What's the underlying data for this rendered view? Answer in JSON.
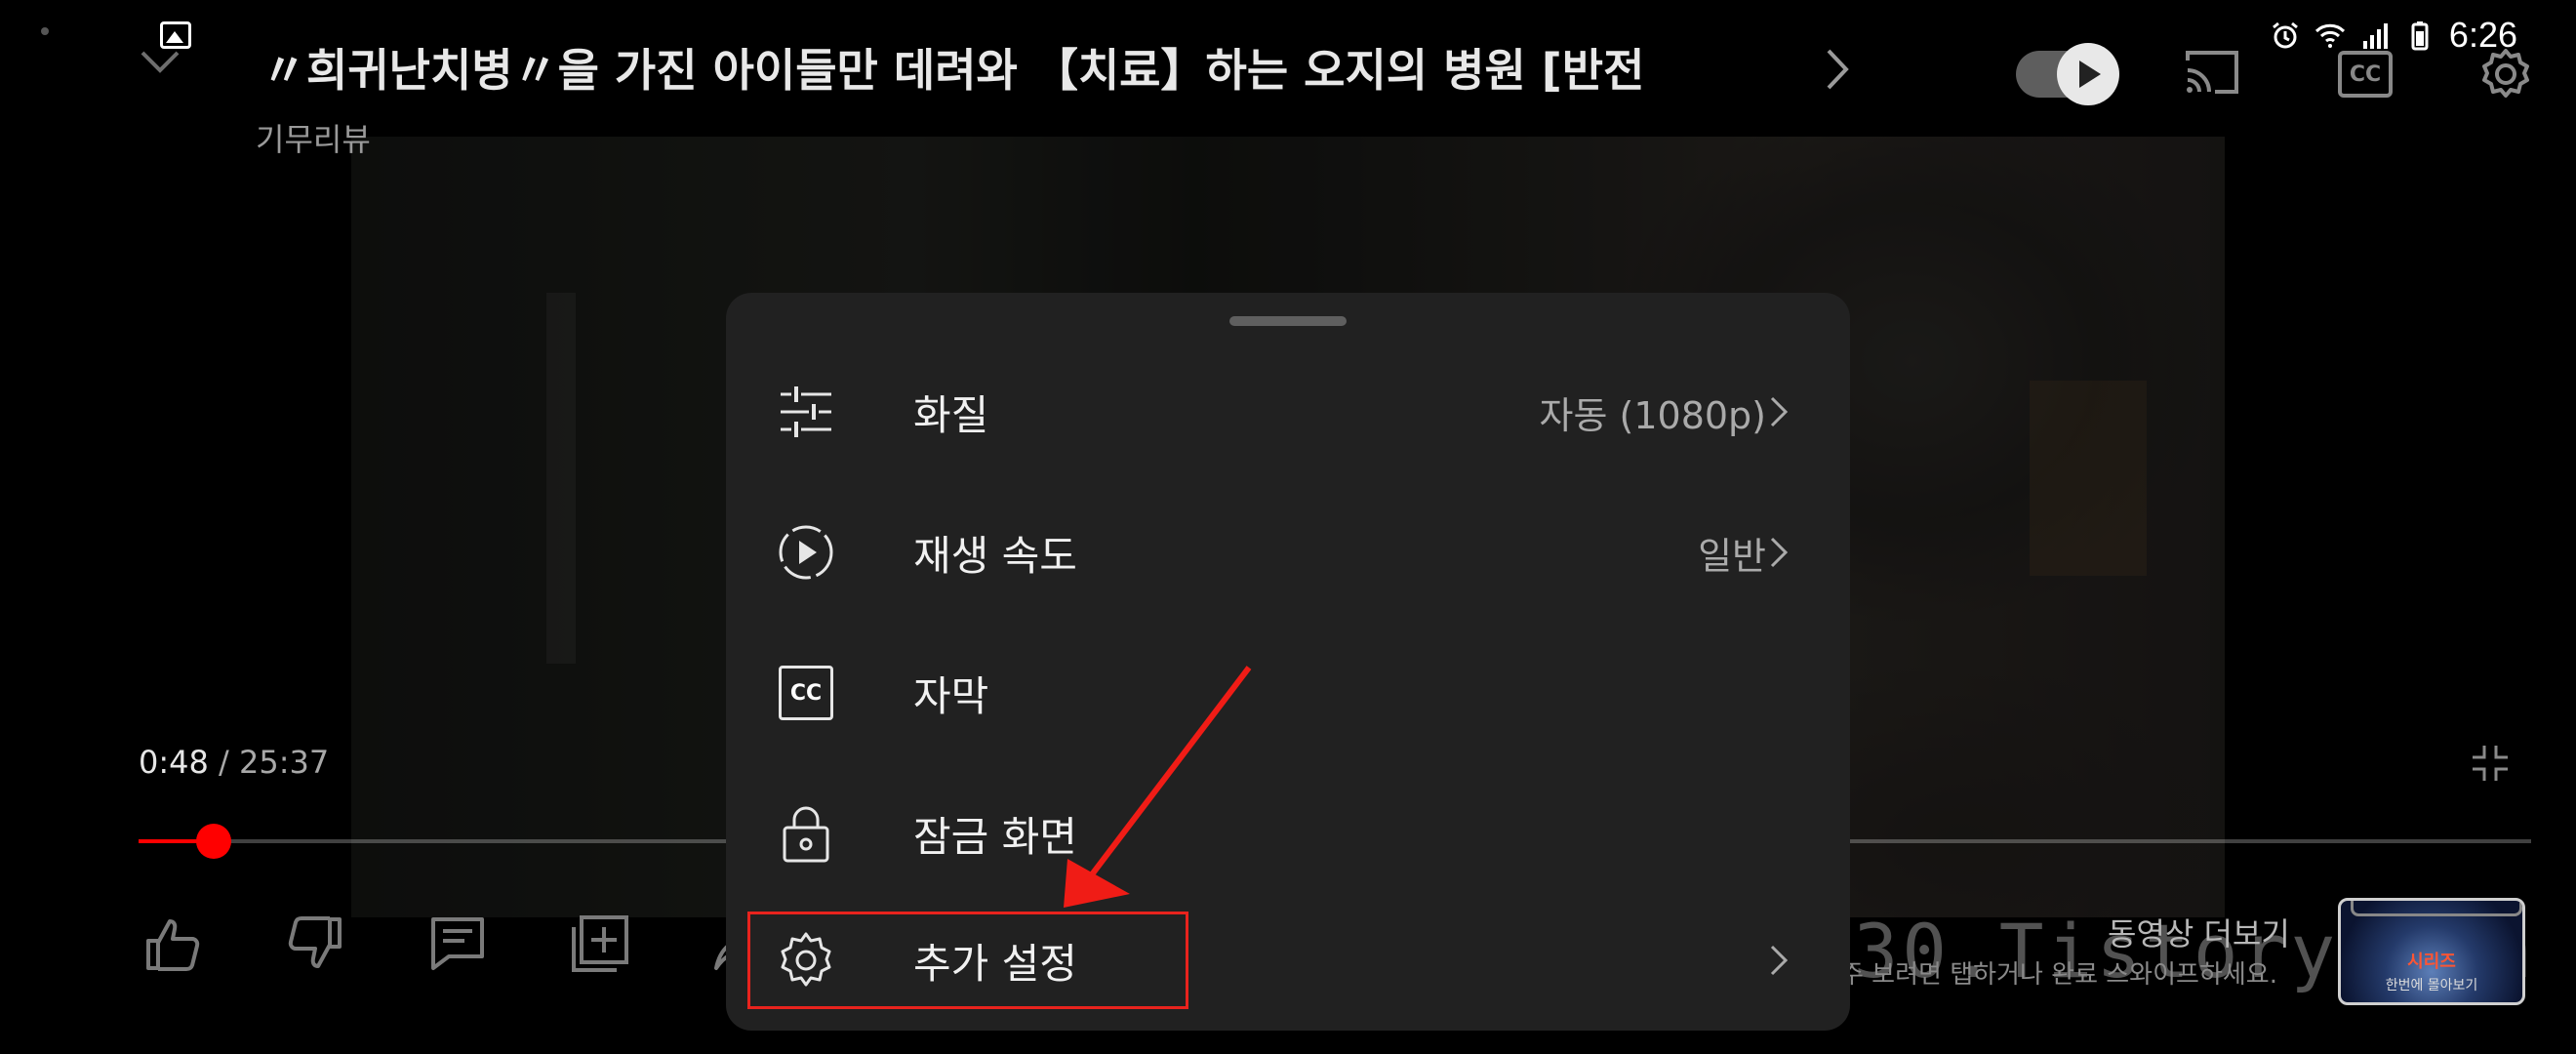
{
  "video": {
    "title": "〃희귀난치병〃을 가진 아이들만 데려와 【치료】하는 오지의 병원 [반전",
    "channel": "기무리뷰"
  },
  "status_bar": {
    "time": "6:26",
    "icons": [
      "gallery-icon",
      "alarm-icon",
      "wifi-icon",
      "signal-icon",
      "battery-icon"
    ]
  },
  "top_bar": {
    "icons": [
      "chevron-down-icon",
      "chevron-right-icon",
      "autoplay-toggle",
      "cast-icon",
      "cc-icon",
      "gear-icon"
    ],
    "cc_label": "CC",
    "autoplay_on": true
  },
  "player": {
    "current_time": "0:48",
    "separator": "/",
    "duration": "25:37",
    "progress_fraction": 0.0312,
    "accent_color": "#ff0000"
  },
  "action_icons": [
    "thumbs-up-icon",
    "thumbs-down-icon",
    "comment-icon",
    "add-to-playlist-icon",
    "share-icon"
  ],
  "more_videos": {
    "label": "동영상 더보기",
    "hint": "주 보려면 탭하거나 완료 스와이프하세요.",
    "thumb_title": "시리즈",
    "thumb_sub": "한번에 몰아보기"
  },
  "watermark": "1730.Tistory.com",
  "settings_sheet": {
    "rows": [
      {
        "icon": "quality-sliders-icon",
        "label": "화질",
        "value": "자동 (1080p)",
        "has_chevron": true
      },
      {
        "icon": "playback-speed-icon",
        "label": "재생 속도",
        "value": "일반",
        "has_chevron": true
      },
      {
        "icon": "cc-icon",
        "label": "자막",
        "value": "",
        "has_chevron": false
      },
      {
        "icon": "lock-icon",
        "label": "잠금 화면",
        "value": "",
        "has_chevron": false
      },
      {
        "icon": "gear-icon",
        "label": "추가 설정",
        "value": "",
        "has_chevron": true
      }
    ],
    "cc_label": "CC"
  },
  "annotation": {
    "highlight_color": "#e8231d",
    "target": "추가 설정"
  }
}
